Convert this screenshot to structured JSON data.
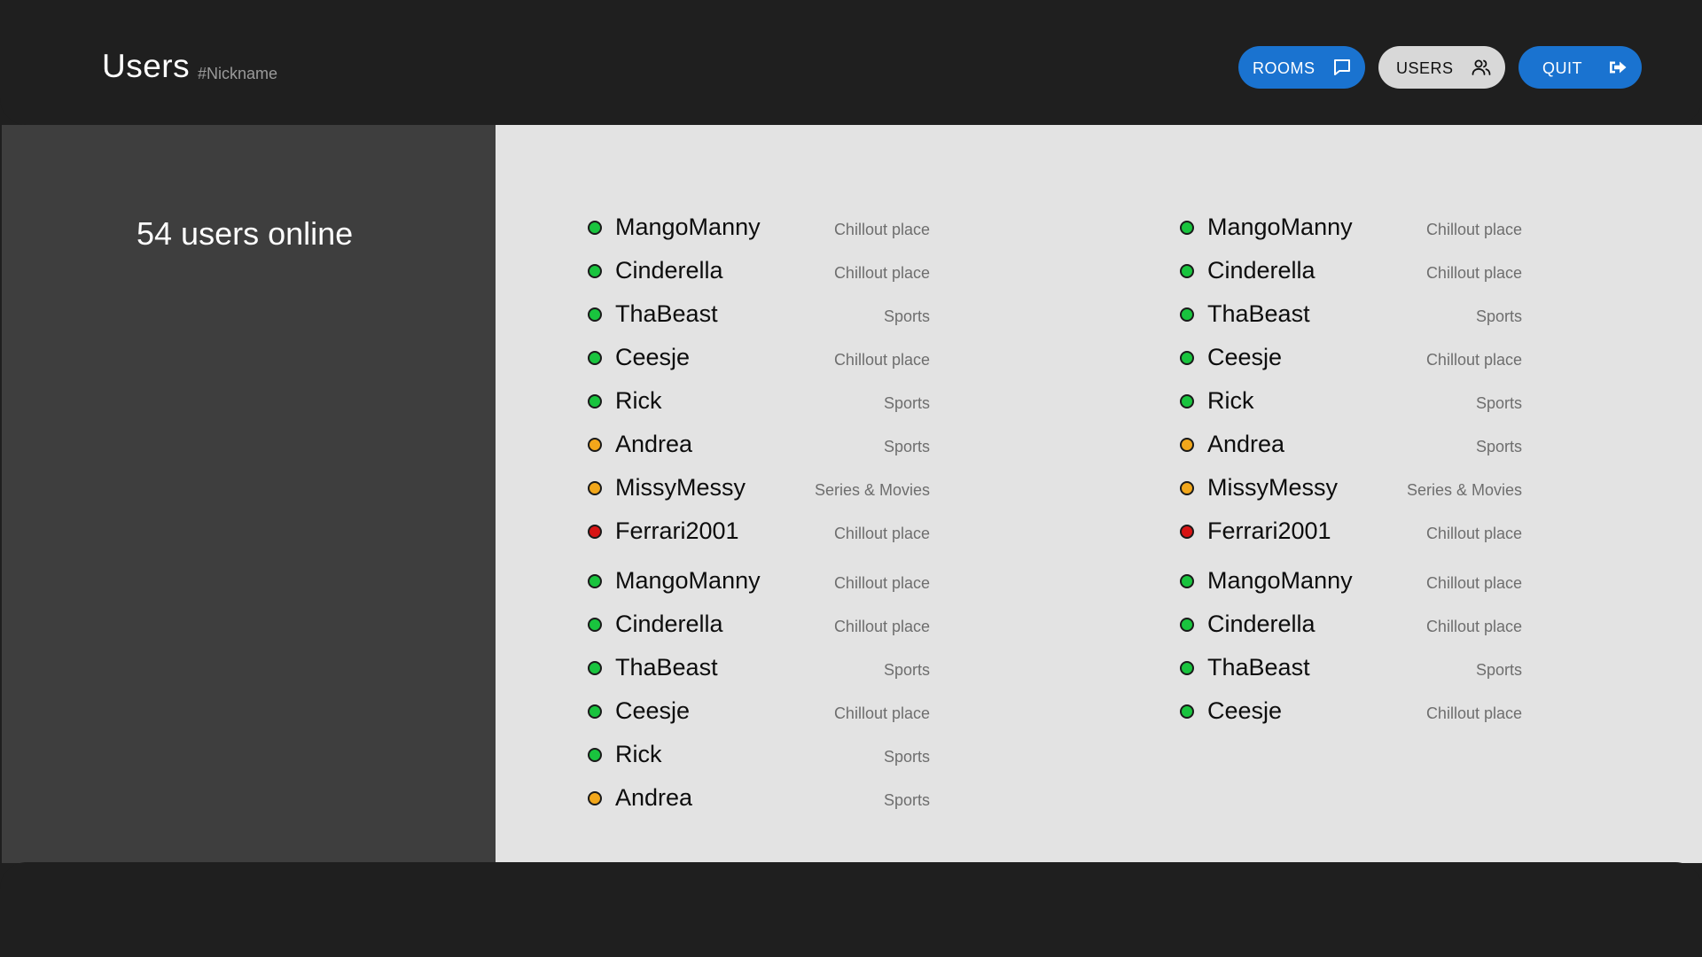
{
  "header": {
    "title": "Users",
    "subtitle": "#Nickname",
    "nav": [
      {
        "label": "ROOMS",
        "icon": "chat-bubble-icon"
      },
      {
        "label": "USERS",
        "icon": "users-icon"
      },
      {
        "label": "QUIT",
        "icon": "logout-icon"
      }
    ]
  },
  "sidebar": {
    "online_count": "54 users online"
  },
  "colors": {
    "online": "#19c43e",
    "away": "#f2a71b",
    "busy": "#d81414",
    "accent": "#1a73d0"
  },
  "users": {
    "columns": [
      [
        {
          "name": "MangoManny",
          "room": "Chillout place",
          "status": "online"
        },
        {
          "name": "Cinderella",
          "room": "Chillout place",
          "status": "online"
        },
        {
          "name": "ThaBeast",
          "room": "Sports",
          "status": "online"
        },
        {
          "name": "Ceesje",
          "room": "Chillout place",
          "status": "online"
        },
        {
          "name": "Rick",
          "room": "Sports",
          "status": "online"
        },
        {
          "name": "Andrea",
          "room": "Sports",
          "status": "away"
        },
        {
          "name": "MissyMessy",
          "room": "Series & Movies",
          "status": "away"
        },
        {
          "name": "Ferrari2001",
          "room": "Chillout place",
          "status": "busy"
        },
        {
          "name": "MangoManny",
          "room": "Chillout place",
          "status": "online"
        },
        {
          "name": "Cinderella",
          "room": "Chillout place",
          "status": "online"
        },
        {
          "name": "ThaBeast",
          "room": "Sports",
          "status": "online"
        },
        {
          "name": "Ceesje",
          "room": "Chillout place",
          "status": "online"
        },
        {
          "name": "Rick",
          "room": "Sports",
          "status": "online"
        },
        {
          "name": "Andrea",
          "room": "Sports",
          "status": "away"
        }
      ],
      [
        {
          "name": "MangoManny",
          "room": "Chillout place",
          "status": "online"
        },
        {
          "name": "Cinderella",
          "room": "Chillout place",
          "status": "online"
        },
        {
          "name": "ThaBeast",
          "room": "Sports",
          "status": "online"
        },
        {
          "name": "Ceesje",
          "room": "Chillout place",
          "status": "online"
        },
        {
          "name": "Rick",
          "room": "Sports",
          "status": "online"
        },
        {
          "name": "Andrea",
          "room": "Sports",
          "status": "away"
        },
        {
          "name": "MissyMessy",
          "room": "Series & Movies",
          "status": "away"
        },
        {
          "name": "Ferrari2001",
          "room": "Chillout place",
          "status": "busy"
        },
        {
          "name": "MangoManny",
          "room": "Chillout place",
          "status": "online"
        },
        {
          "name": "Cinderella",
          "room": "Chillout place",
          "status": "online"
        },
        {
          "name": "ThaBeast",
          "room": "Sports",
          "status": "online"
        },
        {
          "name": "Ceesje",
          "room": "Chillout place",
          "status": "online"
        }
      ]
    ]
  }
}
